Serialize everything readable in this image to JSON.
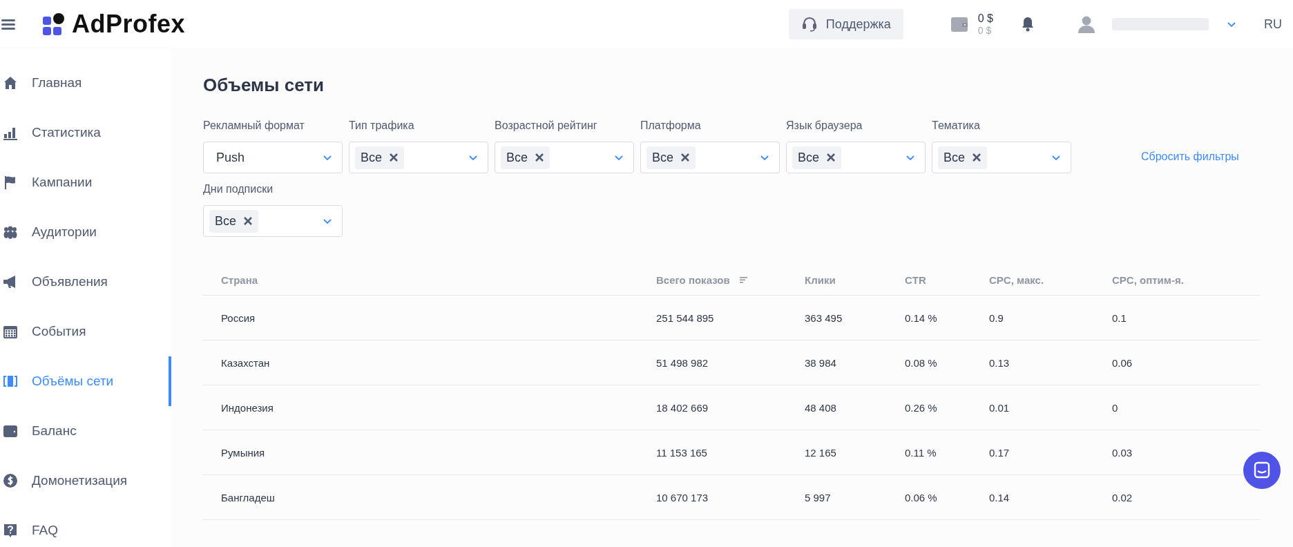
{
  "header": {
    "logo": "AdProfex",
    "support": "Поддержка",
    "balance": "0 $",
    "balance_sub": "0 $",
    "language": "RU"
  },
  "sidebar": {
    "items": [
      {
        "label": "Главная",
        "selected": false
      },
      {
        "label": "Статистика",
        "selected": false
      },
      {
        "label": "Кампании",
        "selected": false
      },
      {
        "label": "Аудитории",
        "selected": false
      },
      {
        "label": "Объявления",
        "selected": false
      },
      {
        "label": "События",
        "selected": false
      },
      {
        "label": "Объёмы сети",
        "selected": true
      },
      {
        "label": "Баланс",
        "selected": false
      },
      {
        "label": "Домонетизация",
        "selected": false
      },
      {
        "label": "FAQ",
        "selected": false
      }
    ]
  },
  "page": {
    "title": "Объемы сети",
    "reset": "Сбросить фильтры"
  },
  "filters": [
    {
      "label": "Рекламный формат",
      "kind": "value",
      "value": "Push"
    },
    {
      "label": "Тип трафика",
      "kind": "chip",
      "value": "Все"
    },
    {
      "label": "Возрастной рейтинг",
      "kind": "chip",
      "value": "Все"
    },
    {
      "label": "Платформа",
      "kind": "chip",
      "value": "Все"
    },
    {
      "label": "Язык браузера",
      "kind": "chip",
      "value": "Все"
    },
    {
      "label": "Тематика",
      "kind": "chip",
      "value": "Все"
    },
    {
      "label": "Дни подписки",
      "kind": "chip",
      "value": "Все"
    }
  ],
  "table": {
    "columns": [
      {
        "label": "Страна",
        "sorted": false
      },
      {
        "label": "Всего показов",
        "sorted": true
      },
      {
        "label": "Клики",
        "sorted": false
      },
      {
        "label": "CTR",
        "sorted": false
      },
      {
        "label": "CPC, макс.",
        "sorted": false
      },
      {
        "label": "CPC, оптим-я.",
        "sorted": false
      }
    ],
    "rows": [
      [
        "Россия",
        "251 544 895",
        "363 495",
        "0.14 %",
        "0.9",
        "0.1"
      ],
      [
        "Казахстан",
        "51 498 982",
        "38 984",
        "0.08 %",
        "0.13",
        "0.06"
      ],
      [
        "Индонезия",
        "18 402 669",
        "48 408",
        "0.26 %",
        "0.01",
        "0"
      ],
      [
        "Румыния",
        "11 153 165",
        "12 165",
        "0.11 %",
        "0.17",
        "0.03"
      ],
      [
        "Бангладеш",
        "10 670 173",
        "5 997",
        "0.06 %",
        "0.14",
        "0.02"
      ]
    ]
  }
}
